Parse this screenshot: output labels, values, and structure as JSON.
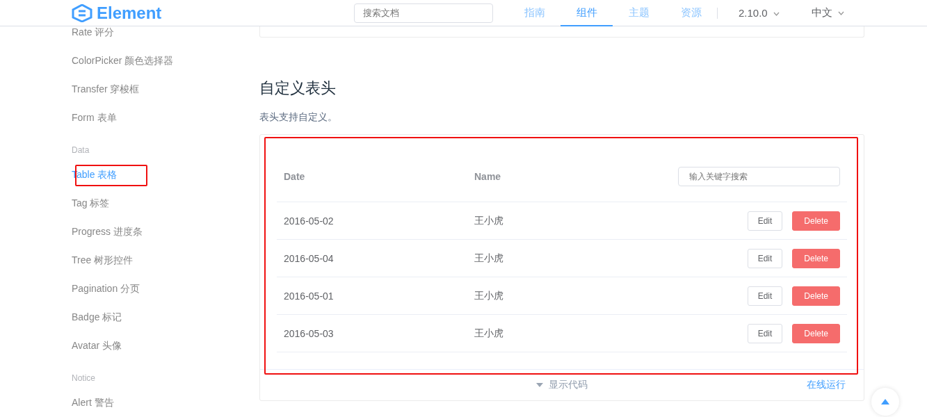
{
  "header": {
    "logo": "Element",
    "search": {
      "placeholder": "搜索文档"
    },
    "nav": [
      {
        "label": "指南",
        "selected": false
      },
      {
        "label": "组件",
        "selected": true
      },
      {
        "label": "主题",
        "selected": false
      },
      {
        "label": "资源",
        "selected": false
      }
    ],
    "version": "2.10.0",
    "language": "中文"
  },
  "sidebar": {
    "items": [
      {
        "kind": "item",
        "label": "Rate 评分",
        "selected": false
      },
      {
        "kind": "item",
        "label": "ColorPicker 颜色选择器",
        "selected": false
      },
      {
        "kind": "item",
        "label": "Transfer 穿梭框",
        "selected": false
      },
      {
        "kind": "item",
        "label": "Form 表单",
        "selected": false
      },
      {
        "kind": "group",
        "label": "Data"
      },
      {
        "kind": "item",
        "label": "Table 表格",
        "selected": true
      },
      {
        "kind": "item",
        "label": "Tag 标签",
        "selected": false
      },
      {
        "kind": "item",
        "label": "Progress 进度条",
        "selected": false
      },
      {
        "kind": "item",
        "label": "Tree 树形控件",
        "selected": false
      },
      {
        "kind": "item",
        "label": "Pagination 分页",
        "selected": false
      },
      {
        "kind": "item",
        "label": "Badge 标记",
        "selected": false
      },
      {
        "kind": "item",
        "label": "Avatar 头像",
        "selected": false
      },
      {
        "kind": "group",
        "label": "Notice"
      },
      {
        "kind": "item",
        "label": "Alert 警告",
        "selected": false
      }
    ]
  },
  "section": {
    "title": "自定义表头",
    "description": "表头支持自定义。"
  },
  "table": {
    "columns": [
      "Date",
      "Name"
    ],
    "search": {
      "placeholder": "输入关键字搜索"
    },
    "rows": [
      {
        "date": "2016-05-02",
        "name": "王小虎",
        "edit": "Edit",
        "delete": "Delete"
      },
      {
        "date": "2016-05-04",
        "name": "王小虎",
        "edit": "Edit",
        "delete": "Delete"
      },
      {
        "date": "2016-05-01",
        "name": "王小虎",
        "edit": "Edit",
        "delete": "Delete"
      },
      {
        "date": "2016-05-03",
        "name": "王小虎",
        "edit": "Edit",
        "delete": "Delete"
      }
    ]
  },
  "demo_footer": {
    "show_code": "显示代码",
    "run_online": "在线运行"
  }
}
